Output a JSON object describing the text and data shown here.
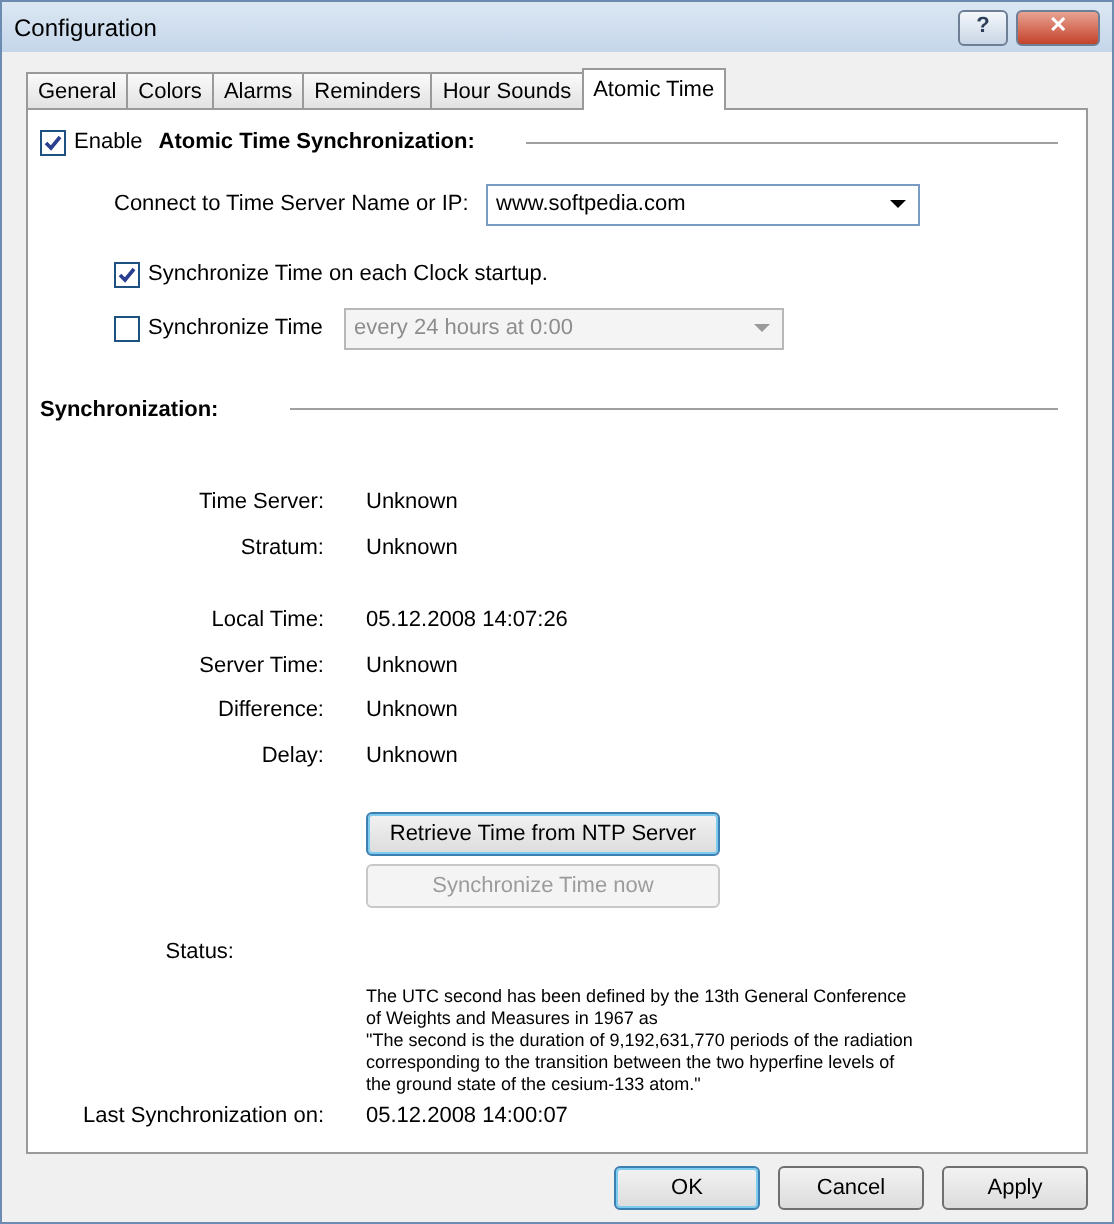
{
  "window": {
    "title": "Configuration",
    "help_button": "?",
    "close_button": "✕"
  },
  "tabs": [
    {
      "label": "General",
      "selected": false
    },
    {
      "label": "Colors",
      "selected": false
    },
    {
      "label": "Alarms",
      "selected": false
    },
    {
      "label": "Reminders",
      "selected": false
    },
    {
      "label": "Hour Sounds",
      "selected": false
    },
    {
      "label": "Atomic Time",
      "selected": true
    }
  ],
  "enable": {
    "label": "Enable",
    "checked": true,
    "heading": "Atomic Time Synchronization:"
  },
  "server": {
    "label": "Connect to Time Server Name or IP:",
    "value": "www.softpedia.com"
  },
  "options": [
    {
      "kind": "check",
      "label": "Synchronize Time on each Clock startup.",
      "checked": true
    },
    {
      "kind": "check-select",
      "label": "Synchronize Time",
      "checked": false,
      "select": "every 24 hours at 0:00",
      "disabled": true
    }
  ],
  "sync_heading": "Synchronization:",
  "info_groups": [
    [
      {
        "label": "Time Server:",
        "value": "Unknown"
      },
      {
        "label": "Stratum:",
        "value": "Unknown"
      }
    ],
    [
      {
        "label": "Local Time:",
        "value": "05.12.2008 14:07:26"
      },
      {
        "label": "Server Time:",
        "value": "Unknown"
      },
      {
        "label": "Difference:",
        "value": "Unknown"
      },
      {
        "label": "Delay:",
        "value": "Unknown"
      }
    ]
  ],
  "actions": [
    {
      "label": "Retrieve Time from NTP Server",
      "disabled": false,
      "focused": true
    },
    {
      "label": "Synchronize Time now",
      "disabled": true,
      "focused": false
    }
  ],
  "status": {
    "label": "Status:",
    "text": "The UTC second has been defined by the 13th General Conference\nof Weights and Measures in 1967 as\n\"The second is the duration of 9,192,631,770 periods of the radiation\ncorresponding to the transition between the two hyperfine levels of\nthe ground state of the cesium-133 atom.\""
  },
  "last_sync": {
    "label": "Last Synchronization on:",
    "value": "05.12.2008 14:00:07"
  },
  "footer_buttons": [
    {
      "label": "OK",
      "default": true
    },
    {
      "label": "Cancel",
      "default": false
    },
    {
      "label": "Apply",
      "default": false
    }
  ]
}
